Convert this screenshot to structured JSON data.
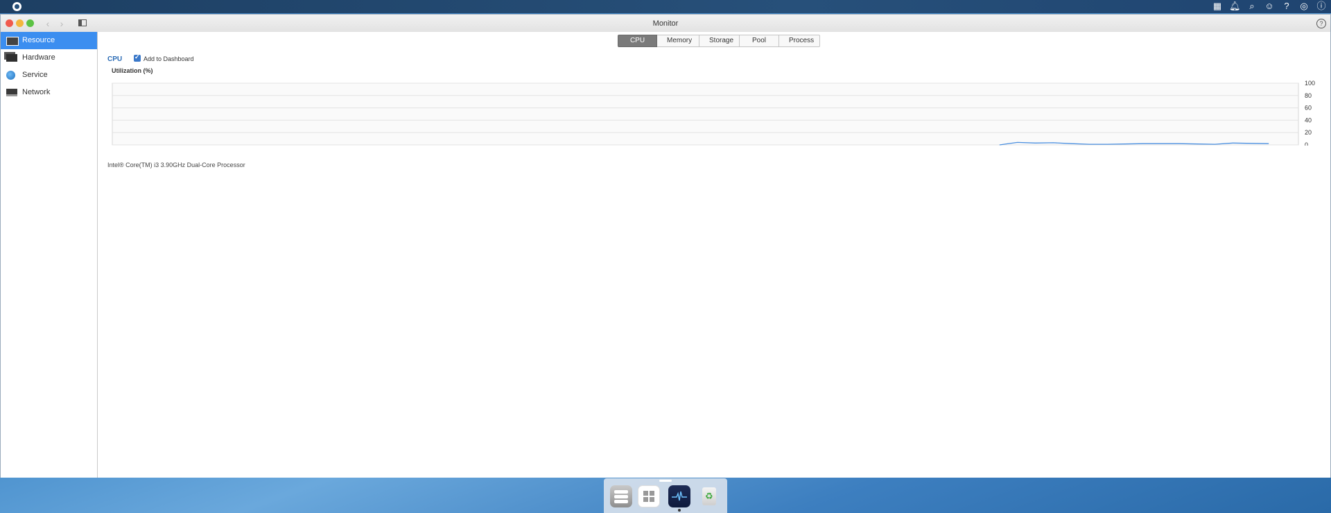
{
  "window": {
    "title": "Monitor"
  },
  "sidebar": {
    "items": [
      {
        "label": "Resource",
        "icon": "resource-monitor-icon",
        "active": true
      },
      {
        "label": "Hardware",
        "icon": "hardware-icon",
        "active": false
      },
      {
        "label": "Service",
        "icon": "globe-icon",
        "active": false
      },
      {
        "label": "Network",
        "icon": "network-icon",
        "active": false
      }
    ]
  },
  "tabs": [
    {
      "label": "CPU",
      "active": true
    },
    {
      "label": "Memory",
      "active": false
    },
    {
      "label": "Storage",
      "active": false
    },
    {
      "label": "Pool",
      "active": false
    },
    {
      "label": "Process",
      "active": false
    }
  ],
  "cpu_section": {
    "title": "CPU",
    "add_to_dashboard_label": "Add to Dashboard",
    "add_to_dashboard_checked": true,
    "utilization_label": "Utilization (%)",
    "processor": "Intel® Core(TM) i3 3.90GHz Dual-Core Processor"
  },
  "chart_data": {
    "type": "line",
    "ylim": [
      0,
      100
    ],
    "yticks": [
      100,
      80,
      60,
      40,
      20,
      0
    ],
    "grid": true,
    "series": [
      {
        "color": "#4a8fe0",
        "points": [
          [
            0,
            0
          ],
          [
            1,
            4
          ],
          [
            2,
            3
          ],
          [
            3,
            3.5
          ],
          [
            4,
            2
          ],
          [
            5,
            1
          ],
          [
            6,
            1
          ],
          [
            7,
            1.5
          ],
          [
            8,
            2
          ],
          [
            9,
            2
          ],
          [
            10,
            2
          ],
          [
            11,
            1.5
          ],
          [
            12,
            1
          ],
          [
            13,
            3
          ],
          [
            14,
            2.5
          ],
          [
            15,
            2
          ]
        ]
      }
    ],
    "series_x_start_fraction": 0.748,
    "series_x_end_fraction": 0.975
  },
  "topbar": {
    "icons": [
      "apps-grid-icon",
      "bell-icon",
      "search-icon",
      "user-icon",
      "help-circle-icon",
      "globe-icon",
      "info-icon"
    ]
  },
  "dock": {
    "apps": [
      "control-panel-app-icon",
      "app-center-icon",
      "resource-monitor-app-icon",
      "recycle-bin-icon"
    ]
  }
}
